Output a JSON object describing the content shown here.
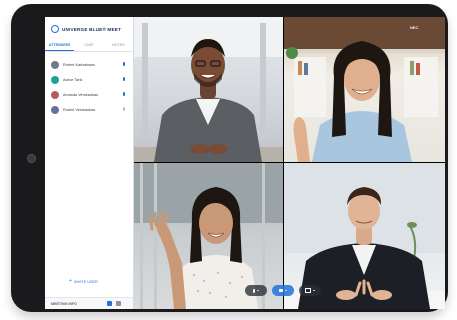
{
  "sidebar": {
    "brand": "UNIVERGE BLUE® MEET",
    "tabs": [
      {
        "label": "ATTENDEES",
        "active": true
      },
      {
        "label": "CHAT",
        "active": false
      },
      {
        "label": "NOTES",
        "active": false
      }
    ],
    "attendees": [
      {
        "name": "Robert Karlsakstes",
        "avatar_color": "#6b7a8f",
        "mic": "on"
      },
      {
        "name": "Active Tank",
        "avatar_color": "#1aa3a0",
        "mic": "on"
      },
      {
        "name": "Amanda Verskaubas",
        "avatar_color": "#b55b62",
        "mic": "on"
      },
      {
        "name": "Robert Verskaubas",
        "avatar_color": "#6c6f9e",
        "mic": "muted"
      }
    ],
    "add_label": "INVITE USER",
    "footer_label": "MEETING INFO"
  },
  "tiles": {
    "top_right_label": "NEC"
  },
  "controls": [
    {
      "icon": "mic-icon"
    },
    {
      "icon": "camera-icon"
    },
    {
      "icon": "screen-share-icon"
    }
  ],
  "colors": {
    "accent": "#1e73d9",
    "brand_text": "#1c2f56",
    "device_frame": "#1a1a1c"
  }
}
